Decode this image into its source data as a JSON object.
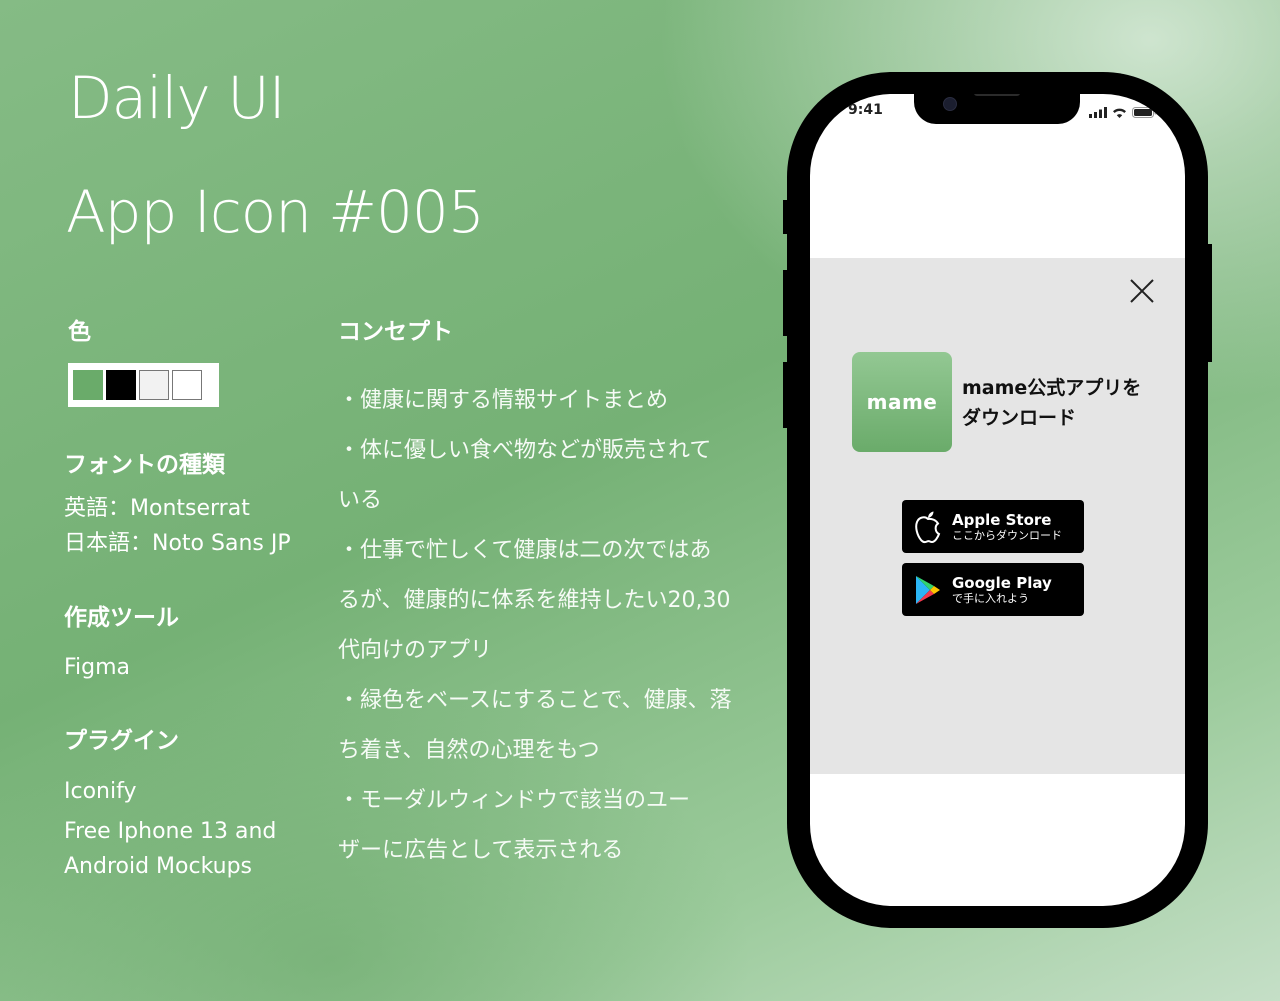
{
  "header": {
    "title": "Daily UI",
    "subtitle": "App Icon  #005"
  },
  "colors_section": {
    "heading": "色",
    "swatches": [
      "#6aab6a",
      "#000000",
      "#f2f2f2",
      "#ffffff"
    ]
  },
  "fonts_section": {
    "heading": "フォントの種類",
    "english": "英語：Montserrat",
    "japanese": "日本語：Noto Sans JP"
  },
  "tools_section": {
    "heading": "作成ツール",
    "value": "Figma"
  },
  "plugins_section": {
    "heading": "プラグイン",
    "items": [
      "Iconify",
      "Free Iphone 13 and",
      "Android Mockups"
    ]
  },
  "concept_section": {
    "heading": "コンセプト",
    "lines": [
      "・健康に関する情報サイトまとめ",
      "・体に優しい食べ物などが販売されて",
      "いる",
      "・仕事で忙しくて健康は二の次ではあ",
      "るが、健康的に体系を維持したい20,30",
      "代向けのアプリ",
      "・緑色をベースにすることで、健康、落",
      "ち着き、自然の心理をもつ",
      "・モーダルウィンドウで該当のユー",
      "ザーに広告として表示される"
    ]
  },
  "phone": {
    "status_time": "9:41",
    "modal": {
      "app_icon_label": "mame",
      "title_line1": "mame公式アプリを",
      "title_line2": "ダウンロード",
      "apple_store": {
        "name": "Apple Store",
        "sub": "ここからダウンロード"
      },
      "google_play": {
        "name": "Google Play",
        "sub": "で手に入れよう"
      }
    }
  }
}
